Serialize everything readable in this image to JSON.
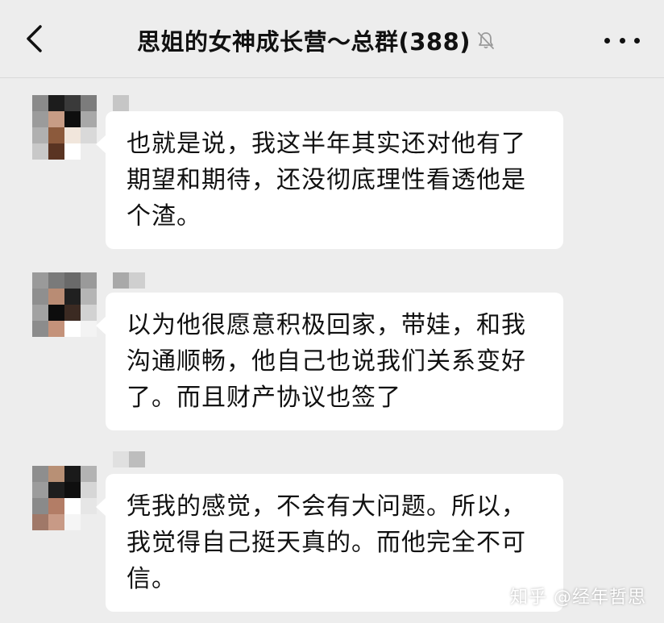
{
  "header": {
    "title": "思姐的女神成长营～总群(388)",
    "back_icon": "chevron-left-icon",
    "mute_icon": "bell-slash-icon",
    "more_icon": "more-dots-icon"
  },
  "messages": [
    {
      "text": "也就是说，我这半年其实还对他有了期望和期待，还没彻底理性看透他是个渣。"
    },
    {
      "text": "以为他很愿意积极回家，带娃，和我沟通顺畅，他自己也说我们关系变好了。而且财产协议也签了"
    },
    {
      "text": "凭我的感觉，不会有大问题。所以，我觉得自己挺天真的。而他完全不可信。"
    }
  ],
  "watermark": "知乎 @经年哲思",
  "colors": {
    "background": "#ededed",
    "bubble": "#ffffff",
    "text": "#111111"
  }
}
